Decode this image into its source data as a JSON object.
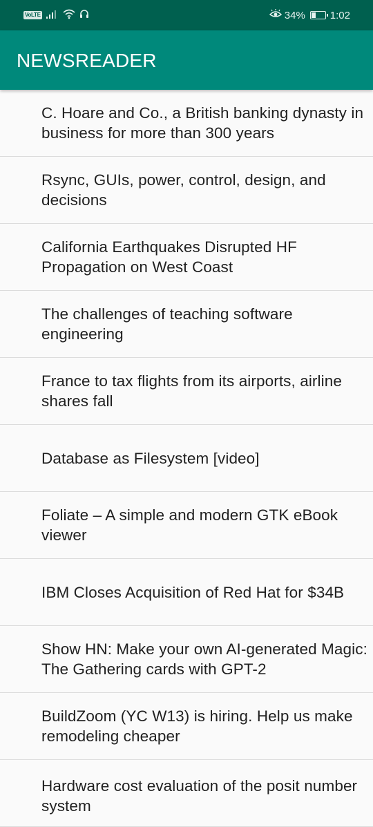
{
  "status_bar": {
    "volte": "VoLTE",
    "battery_percent": "34%",
    "battery_level": 0.34,
    "time": "1:02",
    "icons": [
      "signal-icon",
      "wifi-icon",
      "headset-icon",
      "eye-comfort-icon",
      "battery-icon"
    ]
  },
  "app_bar": {
    "title": "NEWSREADER"
  },
  "colors": {
    "status_bar": "#00604f",
    "app_bar": "#00897b",
    "background": "#fafafa",
    "text": "#212121",
    "divider": "#dcdcdc"
  },
  "articles": [
    {
      "title": "C. Hoare and Co., a British banking dynasty in business for more than 300 years"
    },
    {
      "title": "Rsync, GUIs, power, control, design, and decisions"
    },
    {
      "title": "California Earthquakes Disrupted HF Propagation on West Coast"
    },
    {
      "title": "The challenges of teaching software engineering"
    },
    {
      "title": "France to tax flights from its airports, airline shares fall"
    },
    {
      "title": "Database as Filesystem [video]"
    },
    {
      "title": "Foliate – A simple and modern GTK eBook viewer"
    },
    {
      "title": "IBM Closes Acquisition of Red Hat for $34B"
    },
    {
      "title": "Show HN: Make your own AI-generated Magic: The Gathering cards with GPT-2"
    },
    {
      "title": "BuildZoom (YC W13) is hiring. Help us make remodeling cheaper"
    },
    {
      "title": "Hardware cost evaluation of the posit number system"
    }
  ]
}
